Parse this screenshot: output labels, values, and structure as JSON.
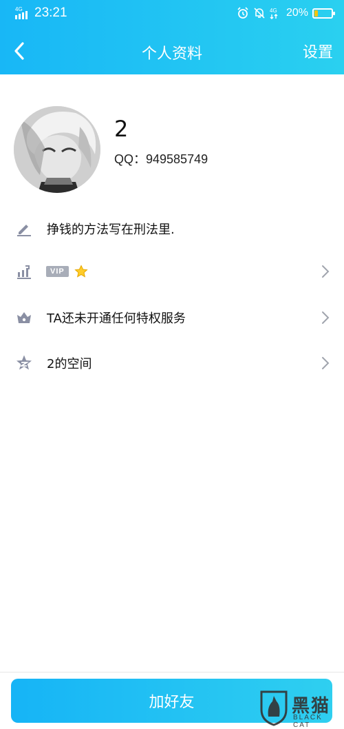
{
  "status_bar": {
    "network": "4G",
    "time": "23:21",
    "right_network": "4G",
    "battery": "20%",
    "battery_level": 0.2,
    "battery_color": "#f4c40f"
  },
  "header": {
    "title": "个人资料",
    "settings_label": "设置",
    "back_icon": "chevron-left-icon",
    "gradient": [
      "#18b7f6",
      "#2ad0f0"
    ]
  },
  "profile": {
    "nickname": "2",
    "qq_label": "QQ：949585749",
    "avatar_icon": "anime-avatar"
  },
  "rows": [
    {
      "icon": "pencil-icon",
      "label": "挣钱的方法写在刑法里.",
      "has_chevron": false
    },
    {
      "icon": "growth-chart-icon",
      "badge": "VIP",
      "badge_icon": "star-icon",
      "has_chevron": true
    },
    {
      "icon": "crown-icon",
      "label": "TA还未开通任何特权服务",
      "has_chevron": true
    },
    {
      "icon": "star-space-icon",
      "label": "2的空间",
      "has_chevron": true
    }
  ],
  "bottom": {
    "add_friend_label": "加好友"
  },
  "watermark": {
    "cn": "黑猫",
    "en": "BLACK CAT"
  }
}
